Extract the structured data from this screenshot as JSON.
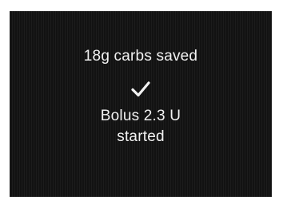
{
  "confirmation": {
    "carbs_message": "18g carbs saved",
    "check_icon": "checkmark-icon",
    "bolus_message": "Bolus 2.3 U",
    "status_message": "started"
  },
  "colors": {
    "screen_background": "#121212",
    "text": "#f2f2f2"
  }
}
